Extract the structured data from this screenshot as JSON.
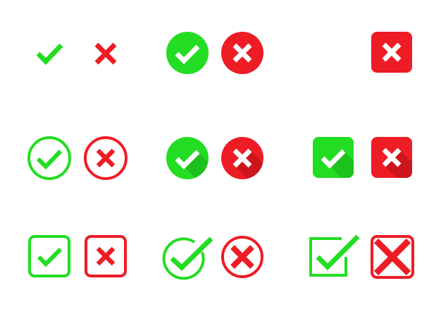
{
  "colors": {
    "green": "#22dd22",
    "green_dark": "#1aaa1a",
    "red": "#ee1c25",
    "red_dark": "#b01018",
    "white": "#ffffff",
    "background": "#ffffff"
  },
  "icon_set": [
    {
      "name": "plain-check-icon",
      "kind": "check",
      "style": "plain"
    },
    {
      "name": "plain-cross-icon",
      "kind": "cross",
      "style": "plain"
    },
    {
      "name": "filled-circle-check-icon",
      "kind": "check",
      "style": "filled-circle"
    },
    {
      "name": "filled-circle-cross-icon",
      "kind": "cross",
      "style": "filled-circle"
    },
    {
      "name": "rounded-square-cross-icon",
      "kind": "cross",
      "style": "filled-rounded-square"
    },
    {
      "name": "outline-circle-check-icon",
      "kind": "check",
      "style": "outline-circle"
    },
    {
      "name": "outline-circle-cross-icon",
      "kind": "cross",
      "style": "outline-circle"
    },
    {
      "name": "long-shadow-circle-check-icon",
      "kind": "check",
      "style": "filled-circle-long-shadow"
    },
    {
      "name": "long-shadow-circle-cross-icon",
      "kind": "cross",
      "style": "filled-circle-long-shadow"
    },
    {
      "name": "long-shadow-square-check-icon",
      "kind": "check",
      "style": "filled-rounded-square-long-shadow"
    },
    {
      "name": "long-shadow-square-cross-icon",
      "kind": "cross",
      "style": "filled-rounded-square-long-shadow"
    },
    {
      "name": "outline-square-check-icon",
      "kind": "check",
      "style": "outline-rounded-square"
    },
    {
      "name": "outline-square-cross-icon",
      "kind": "cross",
      "style": "outline-rounded-square"
    },
    {
      "name": "overflow-circle-check-icon",
      "kind": "check",
      "style": "outline-circle-overflow"
    },
    {
      "name": "overflow-circle-cross-icon",
      "kind": "cross",
      "style": "outline-circle-bold"
    },
    {
      "name": "overflow-square-check-icon",
      "kind": "check",
      "style": "outline-square-overflow"
    },
    {
      "name": "overflow-square-cross-icon",
      "kind": "cross",
      "style": "outline-square-overflow"
    }
  ]
}
